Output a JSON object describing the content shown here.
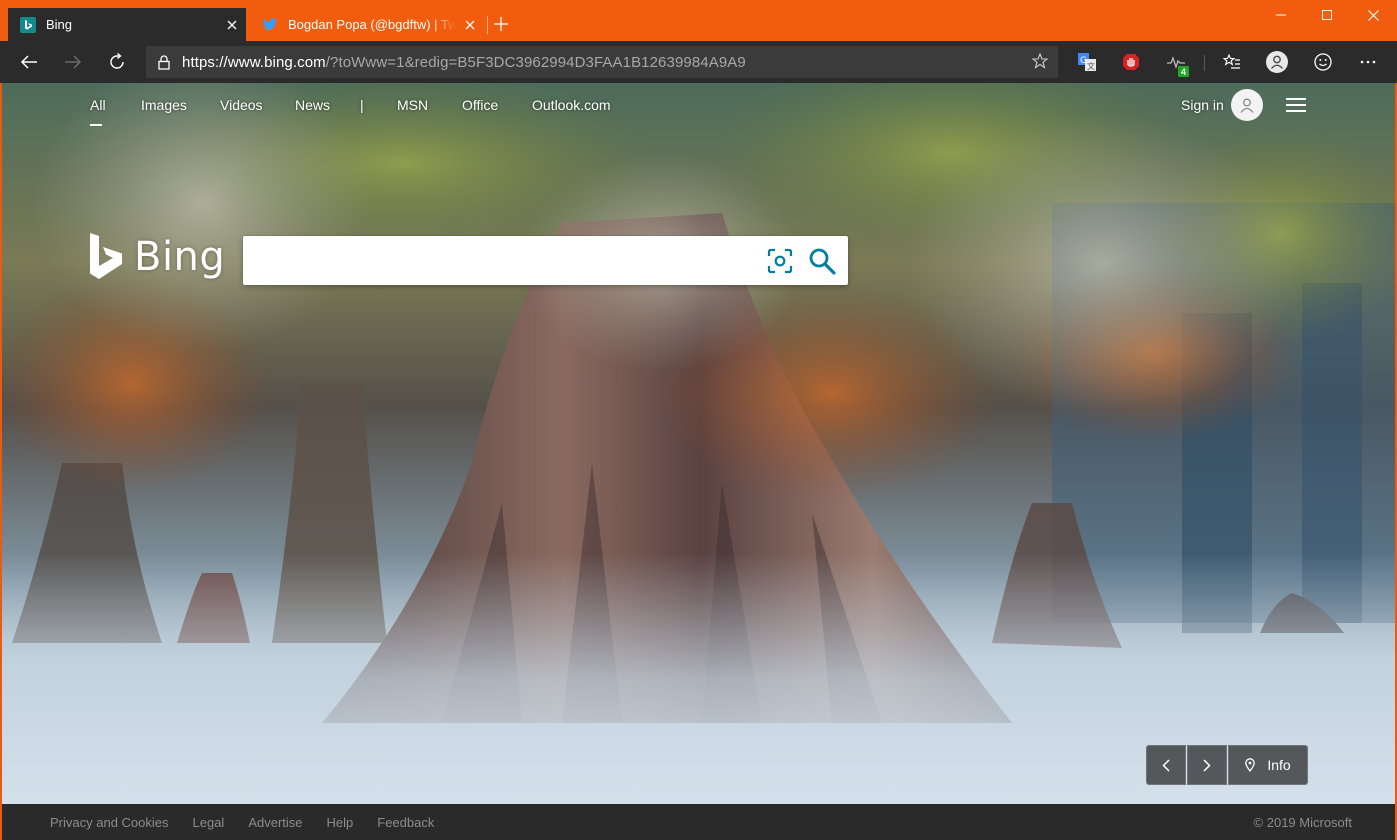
{
  "browser": {
    "tabs": [
      {
        "title": "Bing",
        "favicon": "bing-icon",
        "active": true
      },
      {
        "title": "Bogdan Popa (@bgdftw) | Twitter",
        "favicon": "twitter-icon",
        "active": false
      }
    ],
    "address": {
      "scheme": "https://",
      "host": "www.bing.com",
      "path": "/?toWww=1&redig=B5F3DC3962994D3FAA1B12639984A9A9"
    },
    "extension_badge": "4",
    "accent_color": "#f25c0f"
  },
  "bing": {
    "nav": [
      "All",
      "Images",
      "Videos",
      "News",
      "|",
      "MSN",
      "Office",
      "Outlook.com"
    ],
    "active_nav": "All",
    "sign_in": "Sign in",
    "logo_text": "Bing",
    "search": {
      "value": "",
      "placeholder": ""
    },
    "carousel": {
      "info_label": "Info"
    },
    "footer": {
      "links": [
        "Privacy and Cookies",
        "Legal",
        "Advertise",
        "Help",
        "Feedback"
      ],
      "copyright": "© 2019 Microsoft"
    }
  }
}
